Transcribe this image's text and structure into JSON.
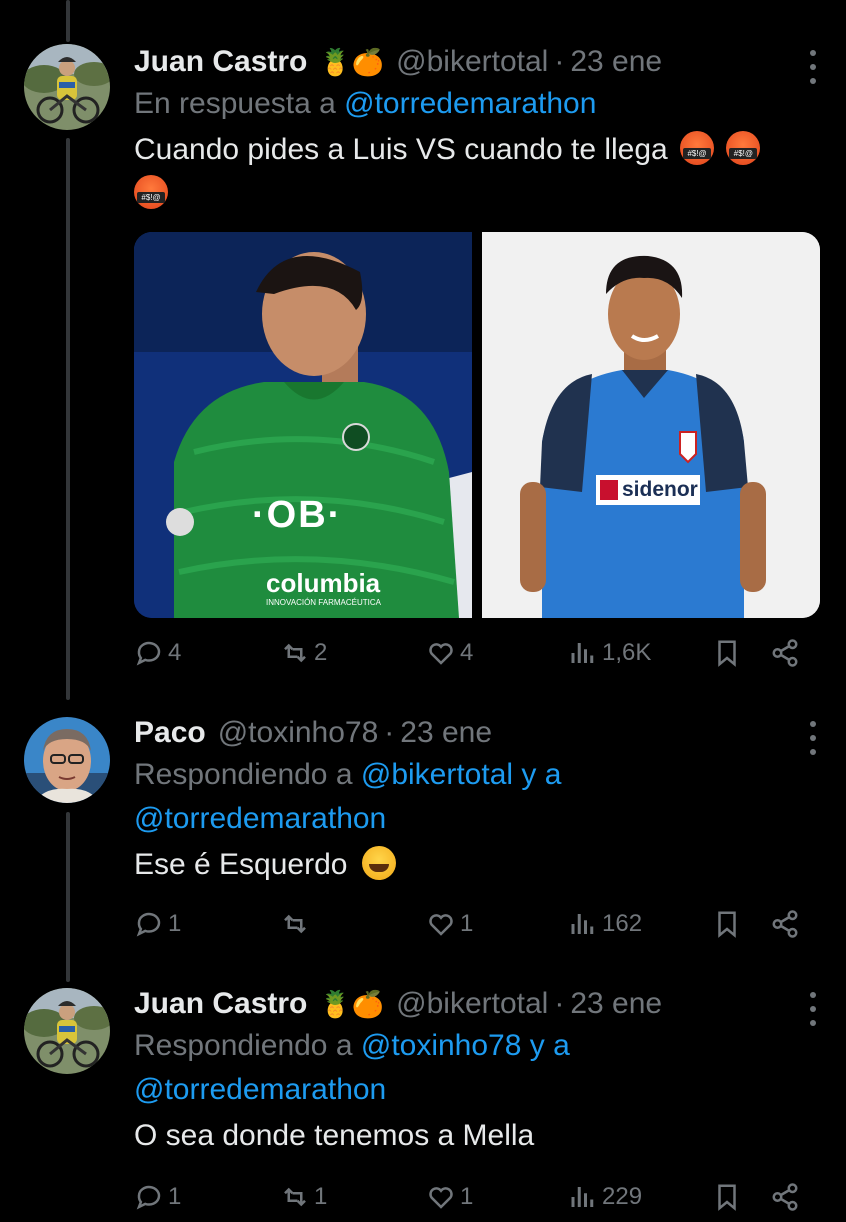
{
  "tweets": [
    {
      "name": "Juan Castro",
      "badges": "🍍🍊",
      "handle": "@bikertotal",
      "date": "23 ene",
      "reply_prefix": "En respuesta a",
      "reply_to": "@torredemarathon",
      "text": "Cuando pides a Luis VS cuando te llega",
      "media": {
        "left": {
          "sponsor": "·OB·",
          "brand": "columbia",
          "tagline": "INNOVACIÓN FARMACÉUTICA"
        },
        "right": {
          "sponsor": "sidenor"
        }
      },
      "stats": {
        "replies": "4",
        "reposts": "2",
        "likes": "4",
        "views": "1,6K"
      }
    },
    {
      "name": "Paco",
      "handle": "@toxinho78",
      "date": "23 ene",
      "reply_prefix": "Respondiendo a",
      "reply_to": "@bikertotal",
      "reply_and": "y a",
      "reply_to_2": "@torredemarathon",
      "text": "Ese é Esquerdo",
      "stats": {
        "replies": "1",
        "reposts": "",
        "likes": "1",
        "views": "162"
      }
    },
    {
      "name": "Juan Castro",
      "badges": "🍍🍊",
      "handle": "@bikertotal",
      "date": "23 ene",
      "reply_prefix": "Respondiendo a",
      "reply_to": "@toxinho78",
      "reply_and": "y a",
      "reply_to_2": "@torredemarathon",
      "text": "O sea donde tenemos a Mella",
      "stats": {
        "replies": "1",
        "reposts": "1",
        "likes": "1",
        "views": "229"
      }
    }
  ],
  "separator": "·",
  "icons": [
    "reply-icon",
    "repost-icon",
    "like-icon",
    "views-icon",
    "bookmark-icon",
    "share-icon",
    "more-icon"
  ],
  "colors": {
    "background": "#000000",
    "text": "#e7e9ea",
    "muted": "#71767b",
    "link": "#1d9bf0"
  }
}
